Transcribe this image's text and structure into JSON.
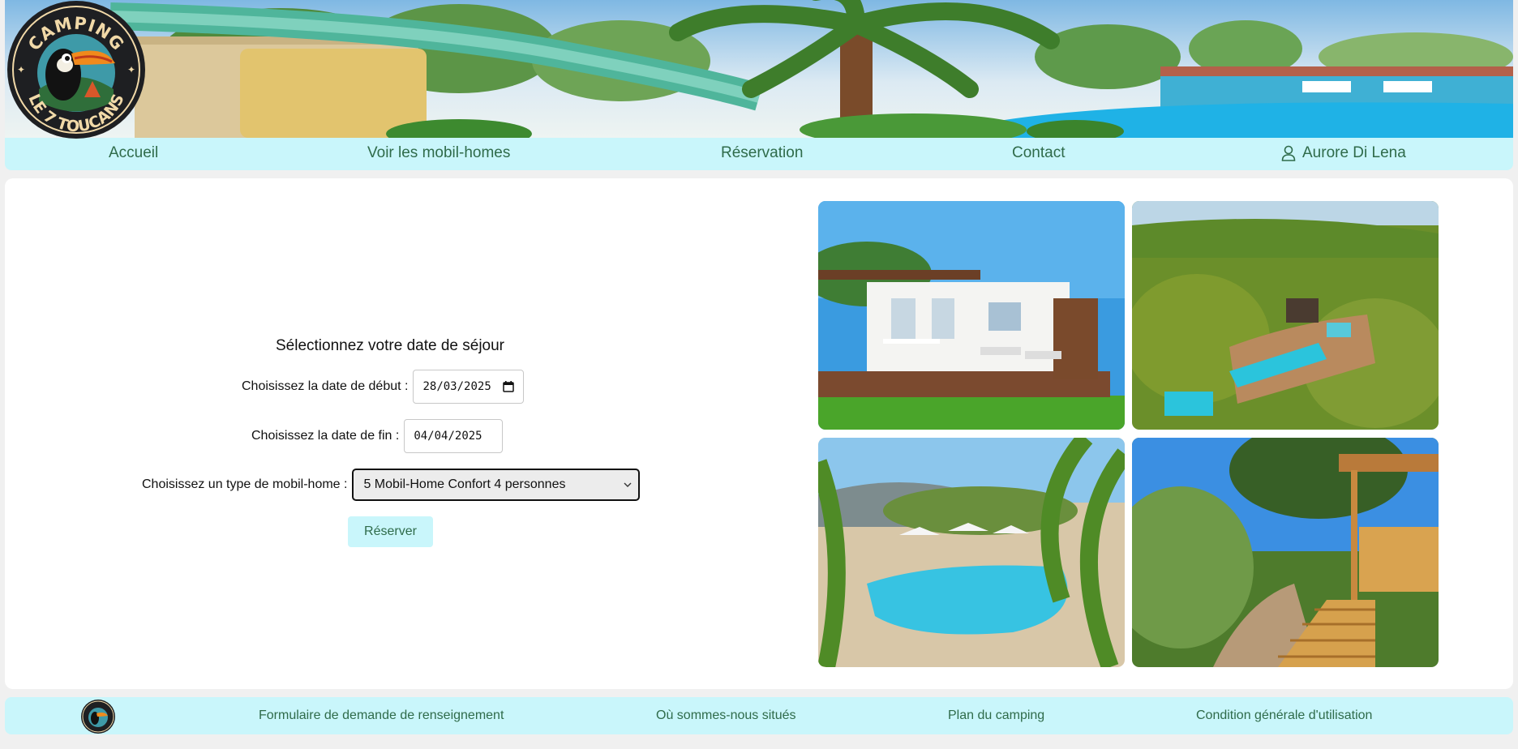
{
  "brand": {
    "logo_top_text": "CAMPING",
    "logo_bottom_text": "LE 7 TOUCANS"
  },
  "nav": {
    "items": [
      {
        "label": "Accueil"
      },
      {
        "label": "Voir les mobil-homes"
      },
      {
        "label": "Réservation"
      },
      {
        "label": "Contact"
      }
    ],
    "user_name": "Aurore Di Lena",
    "user_icon": "user-icon"
  },
  "form": {
    "title": "Sélectionnez votre date de séjour",
    "start_label": "Choisissez la date de début :",
    "start_value": "28/03/2025",
    "end_label": "Choisissez la date de fin :",
    "end_value": "04/04/2025",
    "type_label": "Choisissez un type de mobil-home :",
    "type_value": "5 Mobil-Home Confort 4 personnes",
    "submit_label": "Réserver"
  },
  "gallery": {
    "photos": [
      {
        "subject": "mobil-home terrace"
      },
      {
        "subject": "aerial view with pools"
      },
      {
        "subject": "pool with parasols"
      },
      {
        "subject": "wooden stairs terrace"
      }
    ]
  },
  "footer": {
    "links": [
      {
        "label": "Formulaire de demande de renseignement"
      },
      {
        "label": "Où sommes-nous situés"
      },
      {
        "label": "Plan du camping"
      },
      {
        "label": "Condition générale d'utilisation"
      }
    ]
  },
  "colors": {
    "nav_bg": "#c9f6fb",
    "link_text": "#2f6b4a",
    "page_bg": "#f0f0f0"
  }
}
